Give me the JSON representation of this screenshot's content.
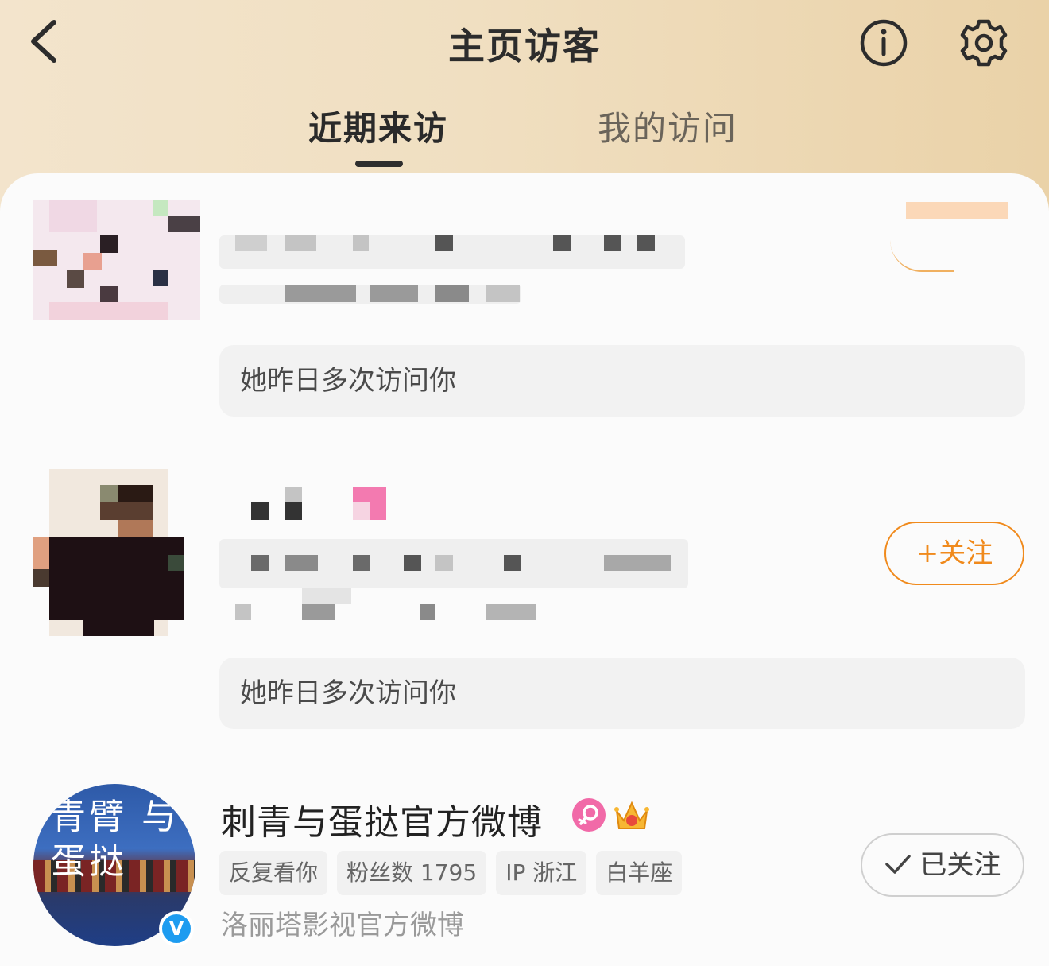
{
  "header": {
    "title": "主页访客",
    "back_icon": "chevron-left-icon",
    "info_icon": "info-icon",
    "settings_icon": "gear-icon"
  },
  "tabs": [
    {
      "label": "近期来访",
      "active": true
    },
    {
      "label": "我的访问",
      "active": false
    }
  ],
  "visitors": [
    {
      "note": "她昨日多次访问你"
    },
    {
      "note": "她昨日多次访问你",
      "follow_label": "+关注"
    },
    {
      "name": "刺青与蛋挞官方微博",
      "tags": [
        "反复看你",
        "粉丝数 1795",
        "IP 浙江",
        "白羊座"
      ],
      "description": "洛丽塔影视官方微博",
      "followed_label": "已关注",
      "verified_badge": "V",
      "avatar_text": "青臂 与 蛋挞"
    }
  ],
  "colors": {
    "accent": "#f08a1c",
    "header_gradient_start": "#f3e4cc",
    "header_gradient_end": "#ead2a8",
    "verified_blue": "#1e9cf0"
  }
}
